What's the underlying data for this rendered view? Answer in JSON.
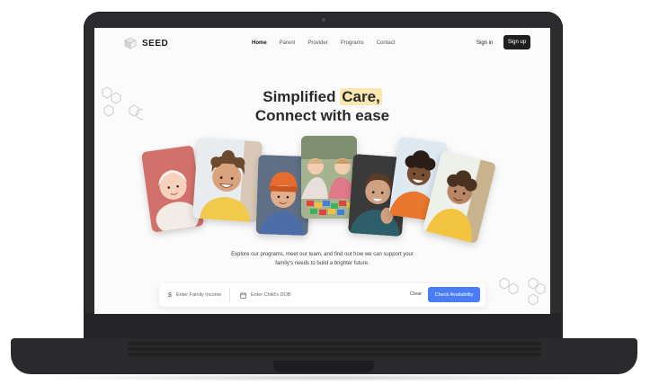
{
  "nav": {
    "brand": "SEED",
    "links": [
      "Home",
      "Parent",
      "Provider",
      "Programs",
      "Contact"
    ],
    "signin": "Sign in",
    "signup": "Sign up"
  },
  "hero": {
    "headline_1": "Simplified ",
    "headline_highlight": "Care,",
    "headline_2": "Connect with ease",
    "description": "Explore our programs, meet our team, and find out how we can support your family's needs to build a brighter future."
  },
  "search": {
    "income_placeholder": "Enter Family Income",
    "dob_placeholder": "Enter Child's DOB",
    "clear": "Clear",
    "submit": "Check Availability"
  },
  "icons": {
    "logo": "cube-logo-icon",
    "income": "dollar-icon",
    "dob": "calendar-icon"
  },
  "colors": {
    "accent": "#4a7df3",
    "highlight": "#fbe7b0",
    "signup_bg": "#1f1f1f"
  }
}
